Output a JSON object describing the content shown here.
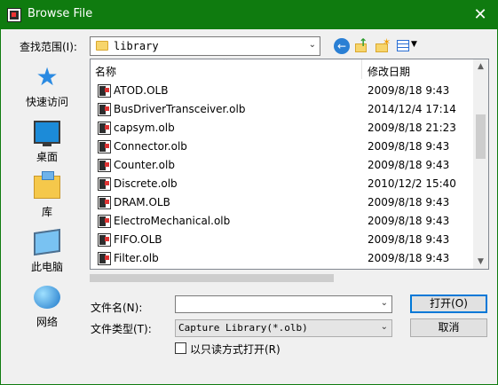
{
  "window": {
    "title": "Browse File",
    "close_glyph": "✕"
  },
  "lookin": {
    "label": "查找范围(I):",
    "value": "library"
  },
  "toolbar": {
    "back_icon": "back-arrow-icon",
    "up_icon": "up-folder-icon",
    "new_folder_icon": "new-folder-icon",
    "view_menu_icon": "view-menu-icon"
  },
  "places": [
    {
      "label": "快速访问",
      "icon": "star-icon"
    },
    {
      "label": "桌面",
      "icon": "desktop-icon"
    },
    {
      "label": "库",
      "icon": "library-icon"
    },
    {
      "label": "此电脑",
      "icon": "computer-icon"
    },
    {
      "label": "网络",
      "icon": "network-icon"
    }
  ],
  "list": {
    "columns": {
      "name": "名称",
      "date": "修改日期"
    },
    "rows": [
      {
        "name": "ATOD.OLB",
        "date": "2009/8/18 9:43"
      },
      {
        "name": "BusDriverTransceiver.olb",
        "date": "2014/12/4 17:14"
      },
      {
        "name": "capsym.olb",
        "date": "2009/8/18 21:23"
      },
      {
        "name": "Connector.olb",
        "date": "2009/8/18 9:43"
      },
      {
        "name": "Counter.olb",
        "date": "2009/8/18 9:43"
      },
      {
        "name": "Discrete.olb",
        "date": "2010/12/2 15:40"
      },
      {
        "name": "DRAM.OLB",
        "date": "2009/8/18 9:43"
      },
      {
        "name": "ElectroMechanical.olb",
        "date": "2009/8/18 9:43"
      },
      {
        "name": "FIFO.OLB",
        "date": "2009/8/18 9:43"
      },
      {
        "name": "Filter.olb",
        "date": "2009/8/18 9:43"
      }
    ]
  },
  "filename": {
    "label": "文件名(N):",
    "value": ""
  },
  "filetype": {
    "label": "文件类型(T):",
    "value": "Capture Library(*.olb)"
  },
  "buttons": {
    "open": "打开(O)",
    "cancel": "取消"
  },
  "readonly": {
    "label": "以只读方式打开(R)",
    "checked": false
  },
  "colors": {
    "titlebar": "#0f7b0f",
    "focus": "#0078d7"
  }
}
